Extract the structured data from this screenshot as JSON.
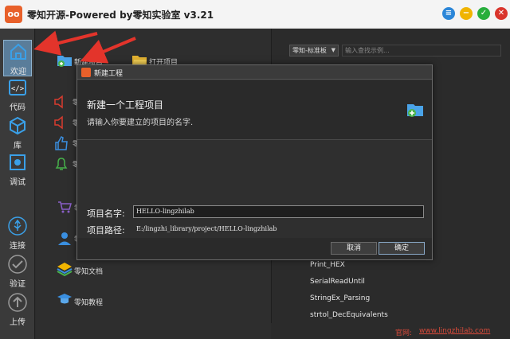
{
  "window": {
    "title": "零知开源-Powered by零知实验室 v3.21",
    "logo_text": "oo",
    "buttons": {
      "menu": "≡",
      "min": "−",
      "max": "✓",
      "close": "✕"
    }
  },
  "sidebar": {
    "items": [
      {
        "label": "欢迎",
        "icon": "home-icon",
        "active": true
      },
      {
        "label": "代码",
        "icon": "code-icon"
      },
      {
        "label": "库",
        "icon": "cube-icon"
      },
      {
        "label": "调试",
        "icon": "bug-icon"
      },
      {
        "label": "连接",
        "icon": "usb-icon"
      },
      {
        "label": "验证",
        "icon": "check-icon"
      },
      {
        "label": "上传",
        "icon": "upload-icon"
      }
    ]
  },
  "middle": {
    "new_project": "新建项目",
    "open_project": "打开项目",
    "truncated_labels": [
      "零",
      "零",
      "零",
      "零",
      "零",
      "零"
    ],
    "docs": "零知文档",
    "tutorials": "零知教程"
  },
  "right": {
    "combo_value": "零知-标准板",
    "search_placeholder": "输入查找示例...",
    "examples": [
      "Print_HEX",
      "SerialReadUntil",
      "StringEx_Parsing",
      "strtol_DecEquivalents"
    ]
  },
  "footer": {
    "label": "官网:",
    "url": "www.lingzhilab.com"
  },
  "dialog": {
    "title": "新建工程",
    "heading": "新建一个工程项目",
    "subheading": "请输入你要建立的项目的名字.",
    "name_label": "项目名字:",
    "name_value": "HELLO-lingzhilab",
    "path_label": "项目路径:",
    "path_value": "E:/lingzhi_library/project/HELLO-lingzhilab",
    "cancel_label": "取消",
    "ok_label": "确定"
  },
  "colors": {
    "accent": "#5a7d9a",
    "brand": "#e8602a",
    "annotation_arrow": "#e3342b"
  }
}
